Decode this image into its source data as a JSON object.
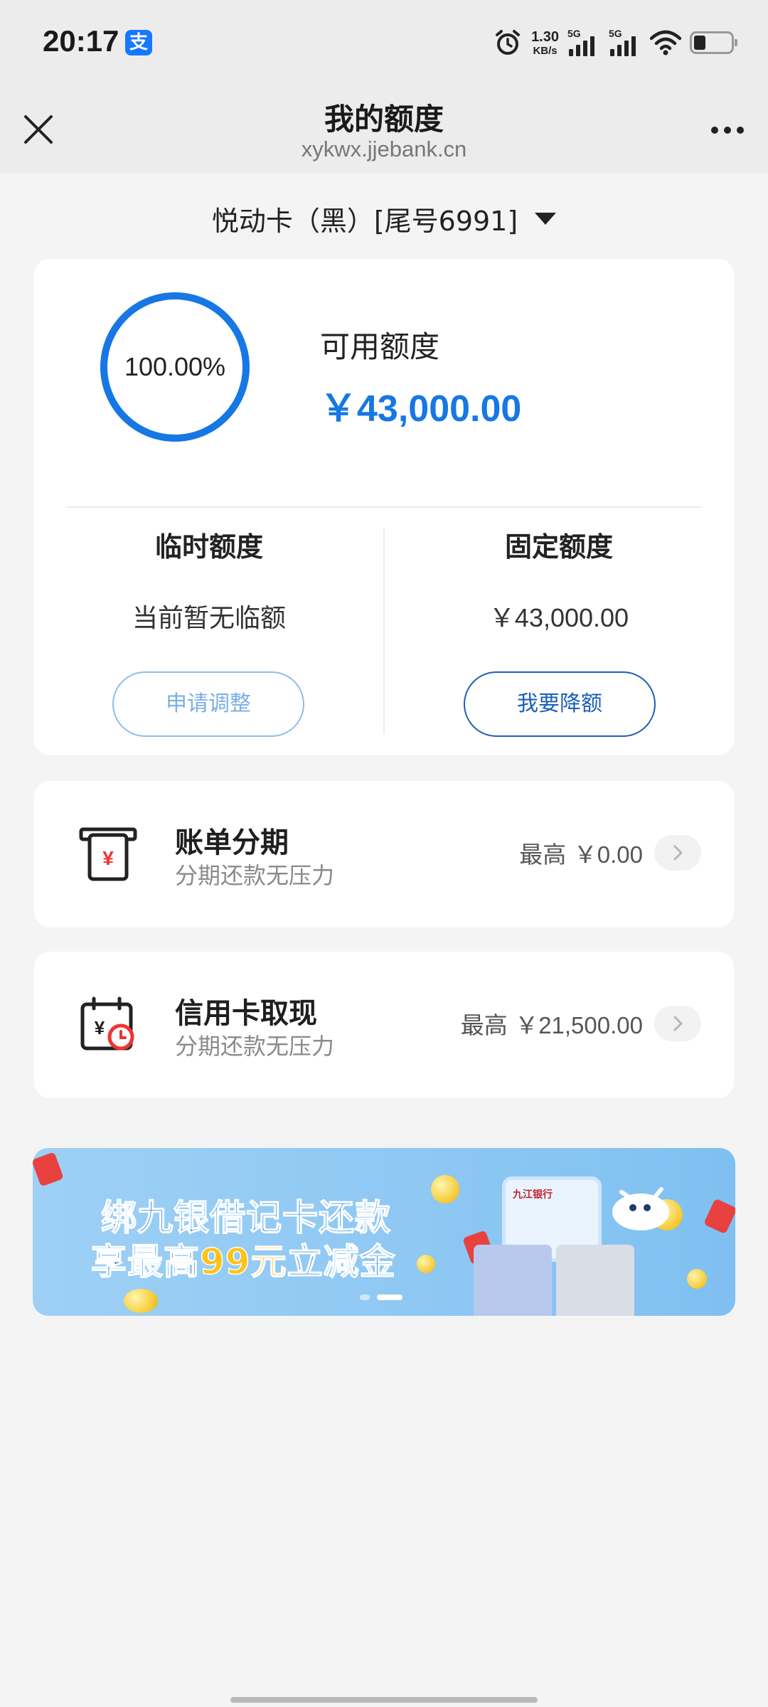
{
  "status_bar": {
    "time": "20:17",
    "app_badge": "支",
    "net_speed_value": "1.30",
    "net_speed_unit": "KB/s",
    "signal1_label": "5G",
    "signal2_label": "5G",
    "icons": [
      "alarm-icon",
      "wifi-icon",
      "battery-icon"
    ]
  },
  "nav": {
    "title": "我的额度",
    "subtitle": "xykwx.jjebank.cn"
  },
  "card_selector": {
    "label": "悦动卡（黑）[尾号6991]"
  },
  "limit": {
    "ring_percent_text": "100.00%",
    "ring_fraction": 1.0,
    "available_label": "可用额度",
    "available_value": "￥43,000.00",
    "temp_title": "临时额度",
    "temp_value": "当前暂无临额",
    "temp_button": "申请调整",
    "fixed_title": "固定额度",
    "fixed_value": "￥43,000.00",
    "fixed_button": "我要降额"
  },
  "rows": [
    {
      "title": "账单分期",
      "subtitle": "分期还款无压力",
      "max_prefix": "最高",
      "max_amount": "￥0.00",
      "icon": "bill-installment-icon"
    },
    {
      "title": "信用卡取现",
      "subtitle": "分期还款无压力",
      "max_prefix": "最高",
      "max_amount": "￥21,500.00",
      "icon": "cash-withdrawal-icon"
    }
  ],
  "banner": {
    "line1": "绑九银借记卡还款",
    "line2_pre": "享最高",
    "line2_hl": "99元",
    "line2_post": "立减金",
    "card_logo": "九江银行"
  },
  "colors": {
    "accent_blue": "#1677e5",
    "button_primary": "#1c5fb8",
    "button_muted": "#7aaee4",
    "page_bg": "#f4f4f5"
  }
}
